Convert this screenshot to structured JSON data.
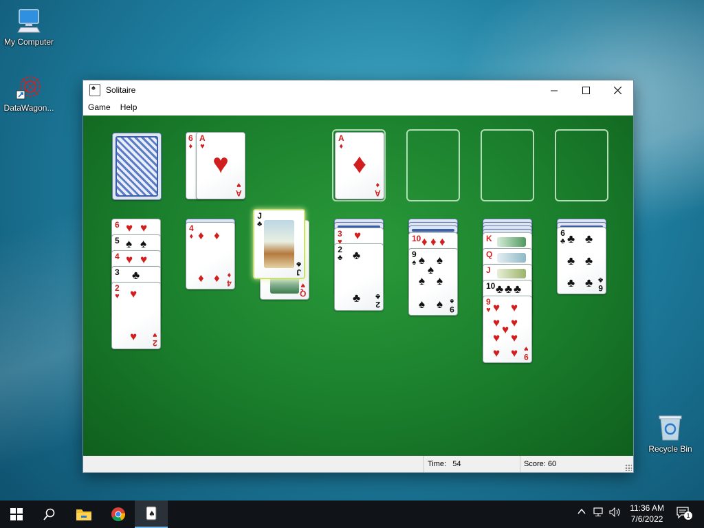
{
  "desktop": {
    "icons": [
      {
        "label": "My Computer",
        "icon": "computer-icon"
      },
      {
        "label": "DataWagon...",
        "icon": "datawagon-icon"
      },
      {
        "label": "Recycle Bin",
        "icon": "recycle-bin-icon"
      }
    ]
  },
  "window": {
    "title": "Solitaire",
    "menu": [
      "Game",
      "Help"
    ],
    "status": {
      "time_label": "Time:",
      "time_value": "54",
      "score_label": "Score: 60"
    }
  },
  "game": {
    "stock": {
      "state": "face-down"
    },
    "waste": [
      {
        "rank": "6",
        "suit": "♦"
      },
      {
        "rank": "A",
        "suit": "♥"
      }
    ],
    "foundations": [
      {
        "rank": "A",
        "suit": "♦"
      },
      null,
      null,
      null
    ],
    "dragging": [
      {
        "rank": "J",
        "suit": "♣"
      },
      {
        "rank": "Q",
        "suit": "♥"
      }
    ],
    "tableau": [
      [
        {
          "rank": "6",
          "suit": "♥"
        },
        {
          "rank": "5",
          "suit": "♠"
        },
        {
          "rank": "4",
          "suit": "♥"
        },
        {
          "rank": "3",
          "suit": "♣"
        },
        {
          "rank": "2",
          "suit": "♥"
        }
      ],
      [
        {
          "rank": "4",
          "suit": "♦"
        }
      ],
      [],
      [
        {
          "rank": "3",
          "suit": "♥"
        },
        {
          "rank": "2",
          "suit": "♣"
        }
      ],
      [
        {
          "rank": "10",
          "suit": "♦"
        },
        {
          "rank": "9",
          "suit": "♠"
        }
      ],
      [
        {
          "rank": "K",
          "suit": "♥"
        },
        {
          "rank": "Q",
          "suit": "♦"
        },
        {
          "rank": "J",
          "suit": "♦"
        },
        {
          "rank": "10",
          "suit": "♣"
        },
        {
          "rank": "9",
          "suit": "♥"
        }
      ],
      [
        {
          "rank": "6",
          "suit": "♣"
        }
      ]
    ]
  },
  "taskbar": {
    "time": "11:36 AM",
    "date": "7/6/2022",
    "notification_count": "1",
    "apps": [
      "start-icon",
      "search-icon",
      "file-explorer-icon",
      "chrome-icon",
      "solitaire-icon"
    ]
  },
  "colors": {
    "felt": "#1a7e2c",
    "red_suit": "#d11f1f",
    "black_suit": "#111111",
    "taskbar": "#101418"
  }
}
